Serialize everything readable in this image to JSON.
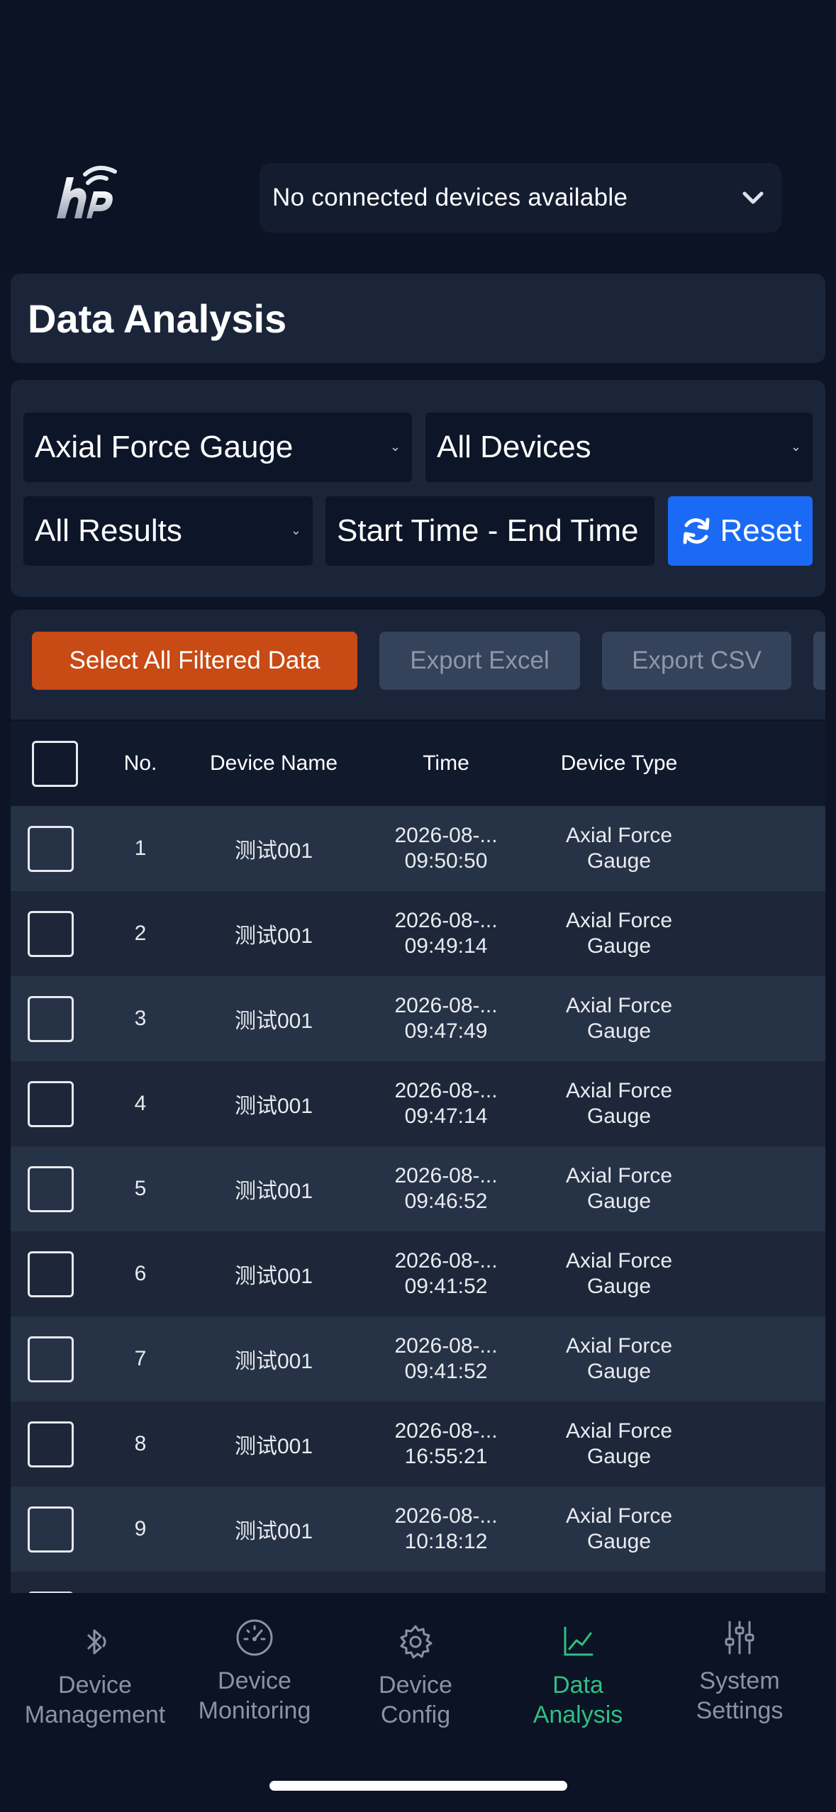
{
  "header": {
    "device_select": "No connected devices available"
  },
  "page": {
    "title": "Data Analysis"
  },
  "filters": {
    "gauge_type": "Axial Force Gauge",
    "devices": "All Devices",
    "results": "All Results",
    "time_range": "Start Time - End Time",
    "reset_label": "Reset"
  },
  "actions": {
    "select_all": "Select All Filtered Data",
    "export_excel": "Export Excel",
    "export_csv": "Export CSV"
  },
  "table": {
    "headers": {
      "no": "No.",
      "device_name": "Device Name",
      "time": "Time",
      "device_type": "Device Type"
    },
    "rows": [
      {
        "no": "1",
        "name": "测试001",
        "date": "2026-08-...",
        "time": "09:50:50",
        "type1": "Axial Force",
        "type2": "Gauge"
      },
      {
        "no": "2",
        "name": "测试001",
        "date": "2026-08-...",
        "time": "09:49:14",
        "type1": "Axial Force",
        "type2": "Gauge"
      },
      {
        "no": "3",
        "name": "测试001",
        "date": "2026-08-...",
        "time": "09:47:49",
        "type1": "Axial Force",
        "type2": "Gauge"
      },
      {
        "no": "4",
        "name": "测试001",
        "date": "2026-08-...",
        "time": "09:47:14",
        "type1": "Axial Force",
        "type2": "Gauge"
      },
      {
        "no": "5",
        "name": "测试001",
        "date": "2026-08-...",
        "time": "09:46:52",
        "type1": "Axial Force",
        "type2": "Gauge"
      },
      {
        "no": "6",
        "name": "测试001",
        "date": "2026-08-...",
        "time": "09:41:52",
        "type1": "Axial Force",
        "type2": "Gauge"
      },
      {
        "no": "7",
        "name": "测试001",
        "date": "2026-08-...",
        "time": "09:41:52",
        "type1": "Axial Force",
        "type2": "Gauge"
      },
      {
        "no": "8",
        "name": "测试001",
        "date": "2026-08-...",
        "time": "16:55:21",
        "type1": "Axial Force",
        "type2": "Gauge"
      },
      {
        "no": "9",
        "name": "测试001",
        "date": "2026-08-...",
        "time": "10:18:12",
        "type1": "Axial Force",
        "type2": "Gauge"
      }
    ]
  },
  "nav": {
    "items": [
      {
        "line1": "Device",
        "line2": "Management",
        "icon": "bluetooth-icon"
      },
      {
        "line1": "Device",
        "line2": "Monitoring",
        "icon": "gauge-icon"
      },
      {
        "line1": "Device",
        "line2": "Config",
        "icon": "gear-icon"
      },
      {
        "line1": "Data",
        "line2": "Analysis",
        "icon": "chart-line-icon"
      },
      {
        "line1": "System",
        "line2": "Settings",
        "icon": "sliders-icon"
      }
    ],
    "active_color": "#2fbf83"
  },
  "colors": {
    "accent": "#1a6af5",
    "select_all": "#c84a14"
  }
}
